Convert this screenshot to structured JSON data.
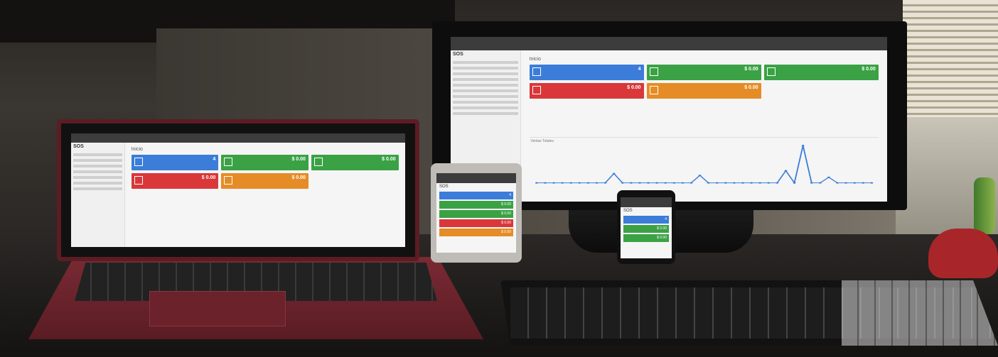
{
  "app": {
    "logo": "SOS",
    "page_title": "Inicio",
    "chart_heading": "Ventas Totales"
  },
  "tiles": [
    {
      "value": "4",
      "icon": "receipt-icon",
      "color": "#3b7dd8"
    },
    {
      "value": "$ 0.00",
      "icon": "money-icon",
      "color": "#3aa245"
    },
    {
      "value": "$ 0.00",
      "icon": "money-icon",
      "color": "#3aa245"
    },
    {
      "value": "$ 0.00",
      "icon": "cart-icon",
      "color": "#d9373a"
    },
    {
      "value": "$ 0.00",
      "icon": "upload-icon",
      "color": "#e58c26"
    }
  ],
  "chart_data": {
    "type": "line",
    "values": [
      0,
      0,
      0,
      0,
      0,
      0,
      0,
      0,
      0,
      1,
      0,
      0,
      0,
      0,
      0,
      0,
      0,
      0,
      0,
      0.8,
      0,
      0,
      0,
      0,
      0,
      0,
      0,
      0,
      0,
      1.3,
      0,
      4,
      0,
      0,
      0.6,
      0,
      0,
      0,
      0,
      0
    ]
  }
}
